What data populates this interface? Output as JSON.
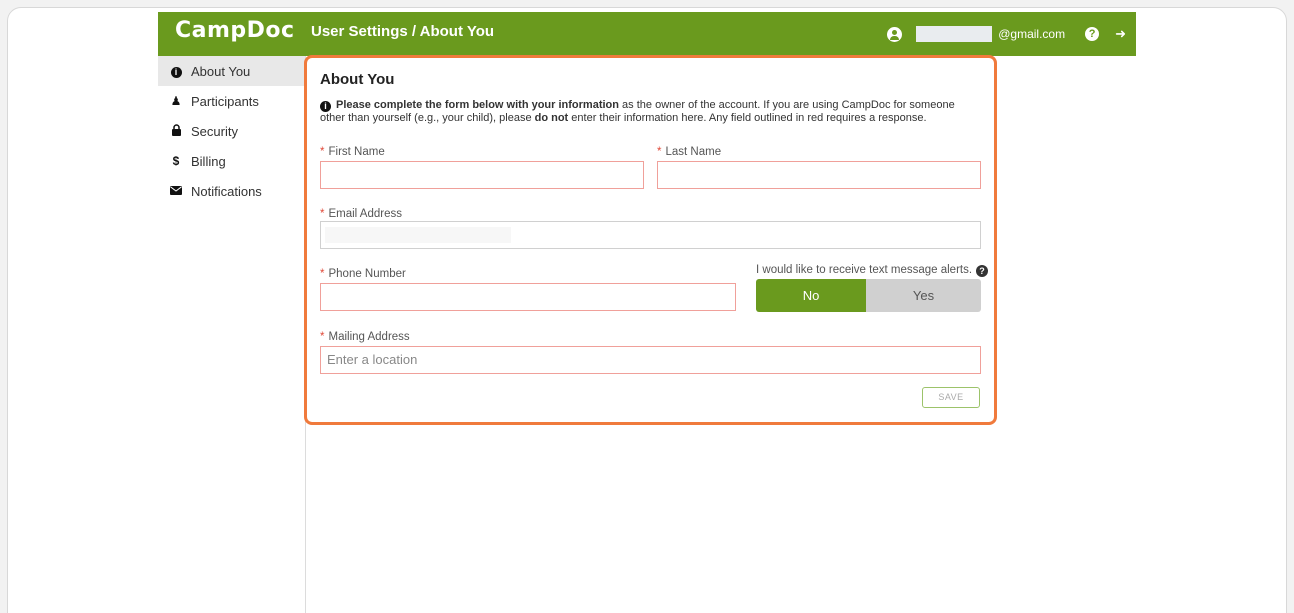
{
  "header": {
    "logo": "CampDoc",
    "title": "User Settings / About You",
    "email_suffix": "@gmail.com",
    "help_icon": "question-circle-icon",
    "logout_icon": "sign-out-icon",
    "user_icon": "user-circle-icon",
    "brand_color": "#6a9a1e"
  },
  "sidebar": {
    "items": [
      {
        "label": "About You",
        "icon": "info-circle-icon",
        "active": true
      },
      {
        "label": "Participants",
        "icon": "users-icon",
        "active": false
      },
      {
        "label": "Security",
        "icon": "lock-icon",
        "active": false
      },
      {
        "label": "Billing",
        "icon": "dollar-icon",
        "active": false
      },
      {
        "label": "Notifications",
        "icon": "envelope-icon",
        "active": false
      }
    ]
  },
  "form": {
    "title": "About You",
    "notice_bold": "Please complete the form below with your information",
    "notice_part1": " as the owner of the account. If you are using CampDoc for someone other than yourself (e.g., your child), please ",
    "notice_bold2": "do not",
    "notice_part2": " enter their information here. Any field outlined in red requires a response.",
    "required_marker": "*",
    "first_name_label": "First Name",
    "first_name_value": "",
    "last_name_label": "Last Name",
    "last_name_value": "",
    "email_label": "Email Address",
    "phone_label": "Phone Number",
    "phone_value": "",
    "text_alerts_label": "I would like to receive text message alerts.",
    "toggle_no": "No",
    "toggle_yes": "Yes",
    "toggle_selected": "No",
    "mailing_label": "Mailing Address",
    "mailing_placeholder": "Enter a location",
    "save_label": "SAVE",
    "highlight_color": "#f07a3c",
    "required_color": "#e04a3a"
  }
}
